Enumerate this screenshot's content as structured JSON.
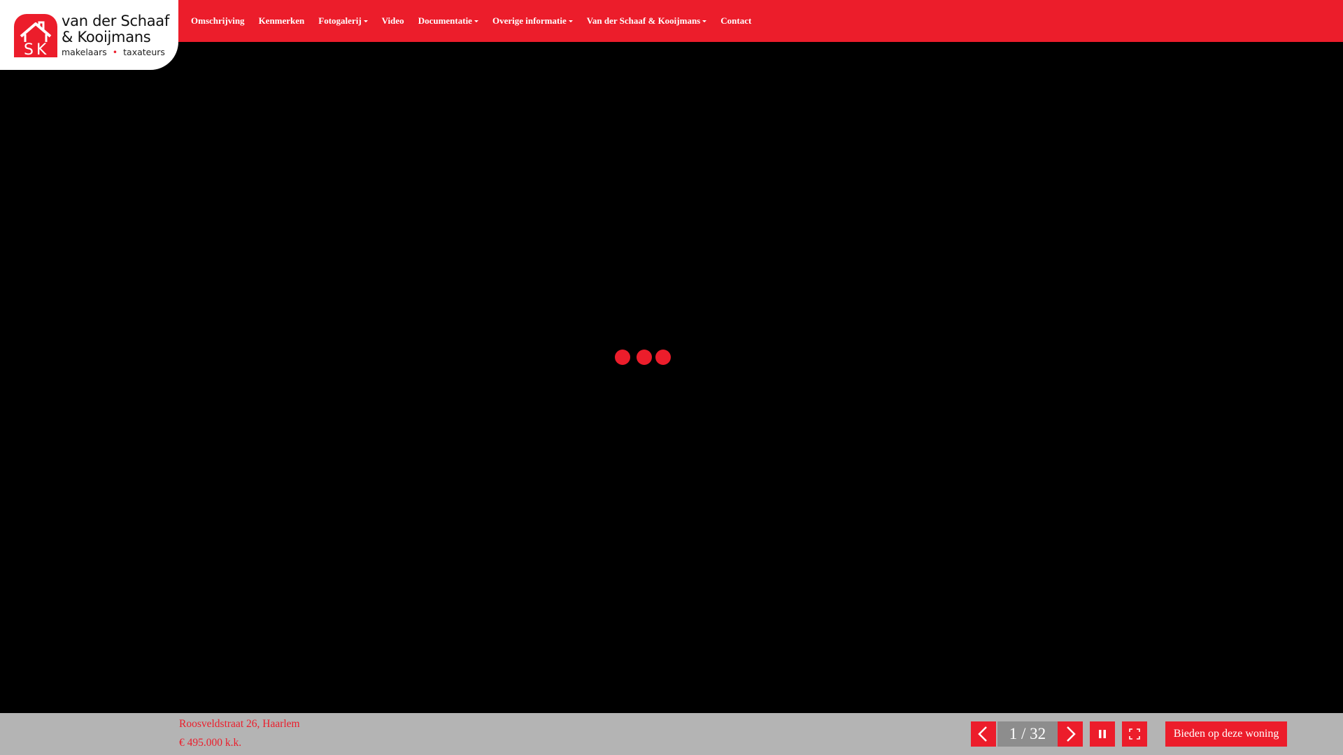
{
  "brand": {
    "name_line1": "van der Schaaf",
    "name_line2": "& Kooijmans",
    "tag_left": "makelaars",
    "tag_dot": "•",
    "tag_right": "taxateurs",
    "accent_color": "#ec1d2b"
  },
  "nav": {
    "items": [
      {
        "label": "Omschrijving",
        "dropdown": false
      },
      {
        "label": "Kenmerken",
        "dropdown": false
      },
      {
        "label": "Fotogalerij",
        "dropdown": true
      },
      {
        "label": "Video",
        "dropdown": false
      },
      {
        "label": "Documentatie",
        "dropdown": true
      },
      {
        "label": "Overige informatie",
        "dropdown": true
      },
      {
        "label": "Van der Schaaf & Kooijmans",
        "dropdown": true
      },
      {
        "label": "Contact",
        "dropdown": false
      }
    ]
  },
  "slideshow": {
    "loading_indicator": "loading-dots",
    "counter": "1 / 32",
    "prev_icon": "chevron-left-icon",
    "next_icon": "chevron-right-icon",
    "pause_icon": "pause-icon",
    "fullscreen_icon": "fullscreen-icon"
  },
  "property": {
    "address": "Roosveldstraat 26, Haarlem",
    "price": "€ 495.000 k.k."
  },
  "actions": {
    "bid_label": "Bieden op deze woning"
  }
}
